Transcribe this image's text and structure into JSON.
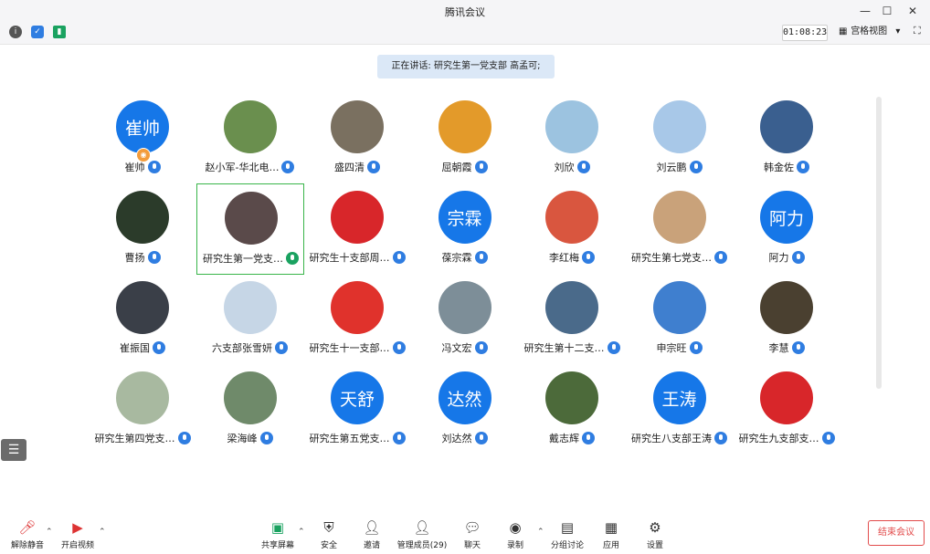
{
  "window": {
    "title": "腾讯会议",
    "minimize": "—",
    "maximize": "☐",
    "close": "✕"
  },
  "toolbar": {
    "timer": "01:08:23",
    "view_mode": "宫格视图",
    "view_caret": "▾"
  },
  "speaking_banner": "正在讲话: 研究生第一党支部 高孟可;",
  "colors": {
    "accent": "#2f7de1",
    "active_border": "#39b54a",
    "end_button": "#e24b4b",
    "banner_bg": "#dbe8f7"
  },
  "participants": [
    {
      "name": "崔帅",
      "avatar_text": "崔帅",
      "avatar_color": "#1677e8",
      "host": true
    },
    {
      "name": "赵小军-华北电…",
      "avatar_text": "",
      "avatar_color": "#6a8f4e"
    },
    {
      "name": "盛四清",
      "avatar_text": "",
      "avatar_color": "#7a7060"
    },
    {
      "name": "屈朝霞",
      "avatar_text": "",
      "avatar_color": "#e39a2a"
    },
    {
      "name": "刘欣",
      "avatar_text": "",
      "avatar_color": "#9cc3e0"
    },
    {
      "name": "刘云鹏",
      "avatar_text": "",
      "avatar_color": "#a8c8e8"
    },
    {
      "name": "韩金佐",
      "avatar_text": "",
      "avatar_color": "#3a5f8f"
    },
    {
      "name": "曹扬",
      "avatar_text": "",
      "avatar_color": "#2b3b2a"
    },
    {
      "name": "研究生第一党支…",
      "avatar_text": "",
      "avatar_color": "#5a4a4a",
      "active": true
    },
    {
      "name": "研究生十支部周…",
      "avatar_text": "",
      "avatar_color": "#d8262a"
    },
    {
      "name": "葆宗霖",
      "avatar_text": "宗霖",
      "avatar_color": "#1677e8"
    },
    {
      "name": "李红梅",
      "avatar_text": "",
      "avatar_color": "#d9563f"
    },
    {
      "name": "研究生第七党支…",
      "avatar_text": "",
      "avatar_color": "#c9a27a"
    },
    {
      "name": "阿力",
      "avatar_text": "阿力",
      "avatar_color": "#1677e8"
    },
    {
      "name": "崔振国",
      "avatar_text": "",
      "avatar_color": "#3a3f48"
    },
    {
      "name": "六支部张雪妍",
      "avatar_text": "",
      "avatar_color": "#c6d6e6"
    },
    {
      "name": "研究生十一支部…",
      "avatar_text": "",
      "avatar_color": "#e0322c"
    },
    {
      "name": "冯文宏",
      "avatar_text": "",
      "avatar_color": "#7d8e98"
    },
    {
      "name": "研究生第十二支…",
      "avatar_text": "",
      "avatar_color": "#4a6a8a"
    },
    {
      "name": "申宗旺",
      "avatar_text": "",
      "avatar_color": "#3f7fcf"
    },
    {
      "name": "李慧",
      "avatar_text": "",
      "avatar_color": "#4a4030"
    },
    {
      "name": "研究生第四党支…",
      "avatar_text": "",
      "avatar_color": "#a8b9a0"
    },
    {
      "name": "梁海峰",
      "avatar_text": "",
      "avatar_color": "#6f8a6a"
    },
    {
      "name": "研究生第五党支…",
      "avatar_text": "天舒",
      "avatar_color": "#1677e8"
    },
    {
      "name": "刘达然",
      "avatar_text": "达然",
      "avatar_color": "#1677e8"
    },
    {
      "name": "戴志辉",
      "avatar_text": "",
      "avatar_color": "#4c6a3a"
    },
    {
      "name": "研究生八支部王涛",
      "avatar_text": "王涛",
      "avatar_color": "#1677e8"
    },
    {
      "name": "研究生九支部支…",
      "avatar_text": "",
      "avatar_color": "#d8262a"
    }
  ],
  "bottom": {
    "unmute": "解除静音",
    "start_video": "开启视频",
    "share": "共享屏幕",
    "security": "安全",
    "invite": "邀请",
    "members": "管理成员(29)",
    "chat": "聊天",
    "record": "录制",
    "breakout": "分组讨论",
    "apps": "应用",
    "settings": "设置",
    "end": "结束会议",
    "caret": "⌃"
  }
}
